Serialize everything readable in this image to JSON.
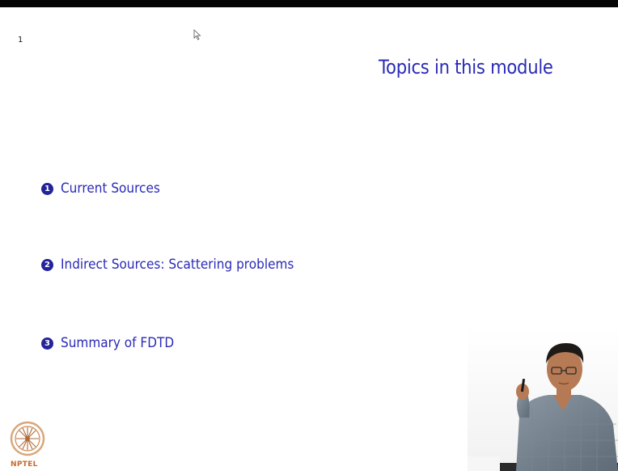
{
  "slide": {
    "number": "1",
    "title": "Topics in this module",
    "topics": [
      {
        "index": "1",
        "label": "Current Sources"
      },
      {
        "index": "2",
        "label": "Indirect Sources: Scattering problems"
      },
      {
        "index": "3",
        "label": "Summary of FDTD"
      }
    ]
  },
  "logo": {
    "text": "NPTEL"
  },
  "colors": {
    "title": "#2a2ab8",
    "bullet": "#23239a",
    "logo_text": "#c9682b",
    "background": "#ffffff"
  },
  "icons": {
    "cursor": "mouse-pointer-icon",
    "logo": "nptel-logo-icon"
  }
}
